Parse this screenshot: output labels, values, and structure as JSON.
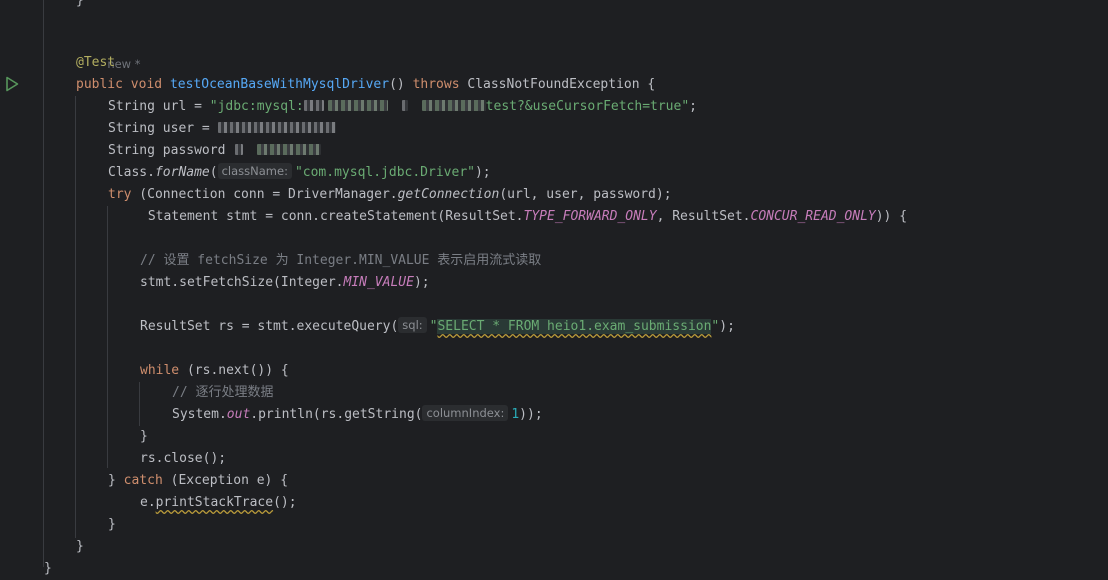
{
  "editor": {
    "author_hint": "new *",
    "annotation": "@Test",
    "method": {
      "modifier": "public",
      "return_type": "void",
      "name": "testOceanBaseWithMysqlDriver",
      "params": "()",
      "throws_kw": "throws",
      "exception": "ClassNotFoundException",
      "brace": "{"
    },
    "url_line": {
      "decl": "String url = ",
      "start": "\"jdbc:mysql:",
      "end": "test?&useCursorFetch=true\"",
      "semi": ";"
    },
    "user_line": {
      "decl": "String user = "
    },
    "password_line": {
      "decl": "String password "
    },
    "forname_line": {
      "class": "Class.",
      "method": "forName",
      "open": "(",
      "hint": "className:",
      "arg": "\"com.mysql.jdbc.Driver\"",
      "close": ");"
    },
    "try_line": {
      "kw": "try",
      "rest1": " (Connection conn = DriverManager.",
      "method": "getConnection",
      "rest2": "(url, user, password);"
    },
    "stmt_line": {
      "part1": " Statement stmt = conn.createStatement(ResultSet.",
      "const1": "TYPE_FORWARD_ONLY",
      "part2": ", ResultSet.",
      "const2": "CONCUR_READ_ONLY",
      "part3": ")) {"
    },
    "comment1": "// 设置 fetchSize 为 Integer.MIN_VALUE 表示启用流式读取",
    "fetch_line": {
      "part1": "stmt.setFetchSize(Integer.",
      "const": "MIN_VALUE",
      "part2": ");"
    },
    "query_line": {
      "part1": "ResultSet rs = stmt.executeQuery(",
      "hint": "sql:",
      "q1": "\"",
      "sql": "SELECT * FROM heio1.exam_submission",
      "q2": "\"",
      "part2": ");"
    },
    "while_line": {
      "kw": "while",
      "rest": " (rs.next()) {"
    },
    "comment2": "// 逐行处理数据",
    "println_line": {
      "part1": "System.",
      "field": "out",
      "part2": ".println(rs.getString(",
      "hint": "columnIndex:",
      "num": "1",
      "part3": "));"
    },
    "close_brace": "}",
    "rs_close": "rs.close();",
    "catch_line": {
      "brace": "} ",
      "kw": "catch",
      "rest": " (Exception e) {"
    },
    "print_line": {
      "part1": "e.",
      "method": "printStackTrace",
      "part2": "();"
    }
  }
}
